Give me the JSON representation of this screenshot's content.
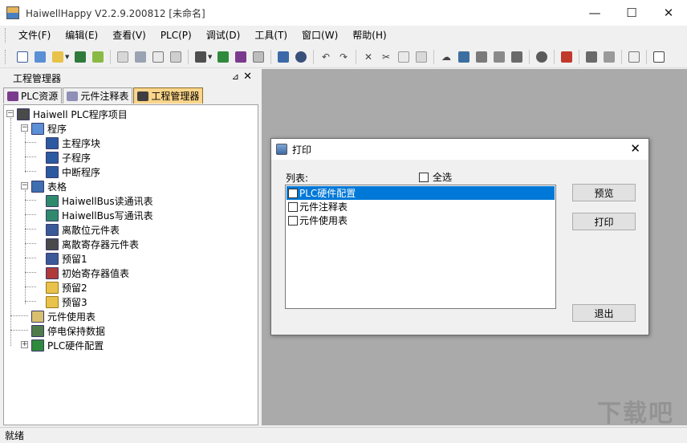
{
  "window": {
    "title": "HaiwellHappy V2.2.9.200812 [未命名]",
    "minimize_glyph": "—",
    "maximize_glyph": "☐",
    "close_glyph": "✕"
  },
  "menu": [
    "文件(F)",
    "编辑(E)",
    "查看(V)",
    "PLC(P)",
    "调试(D)",
    "工具(T)",
    "窗口(W)",
    "帮助(H)"
  ],
  "pane": {
    "title": "工程管理器",
    "pin_glyph": "⊿",
    "close_glyph": "✕",
    "tabs": [
      {
        "label": "PLC资源",
        "icon": "plc-resource-icon",
        "color": "#7a3b8e"
      },
      {
        "label": "元件注释表",
        "icon": "comment-icon",
        "color": "#6b6b9a"
      },
      {
        "label": "工程管理器",
        "icon": "project-icon",
        "color": "#3f3f3f"
      }
    ],
    "tree": {
      "root": "Haiwell PLC程序项目",
      "program": "程序",
      "main_block": "主程序块",
      "sub_program": "子程序",
      "interrupt": "中断程序",
      "tables": "表格",
      "bus_read": "HaiwellBus读通讯表",
      "bus_write": "HaiwellBus写通讯表",
      "discrete_bit": "离散位元件表",
      "discrete_reg": "离散寄存器元件表",
      "reserved1": "预留1",
      "init_reg": "初始寄存器值表",
      "reserved2": "预留2",
      "reserved3": "预留3",
      "element_usage": "元件使用表",
      "power_hold": "停电保持数据",
      "plc_hw": "PLC硬件配置"
    }
  },
  "dialog": {
    "title": "打印",
    "close_glyph": "✕",
    "list_label": "列表:",
    "select_all": "全选",
    "items": [
      "PLC硬件配置",
      "元件注释表",
      "元件使用表"
    ],
    "selected_index": 0,
    "preview_label": "预览",
    "print_label": "打印",
    "exit_label": "退出"
  },
  "status": {
    "text": "就绪"
  },
  "watermark": "下载吧",
  "colors": {
    "selection": "#0078d7",
    "active_tab": "#fbd58a",
    "workspace": "#aaaaaa"
  }
}
